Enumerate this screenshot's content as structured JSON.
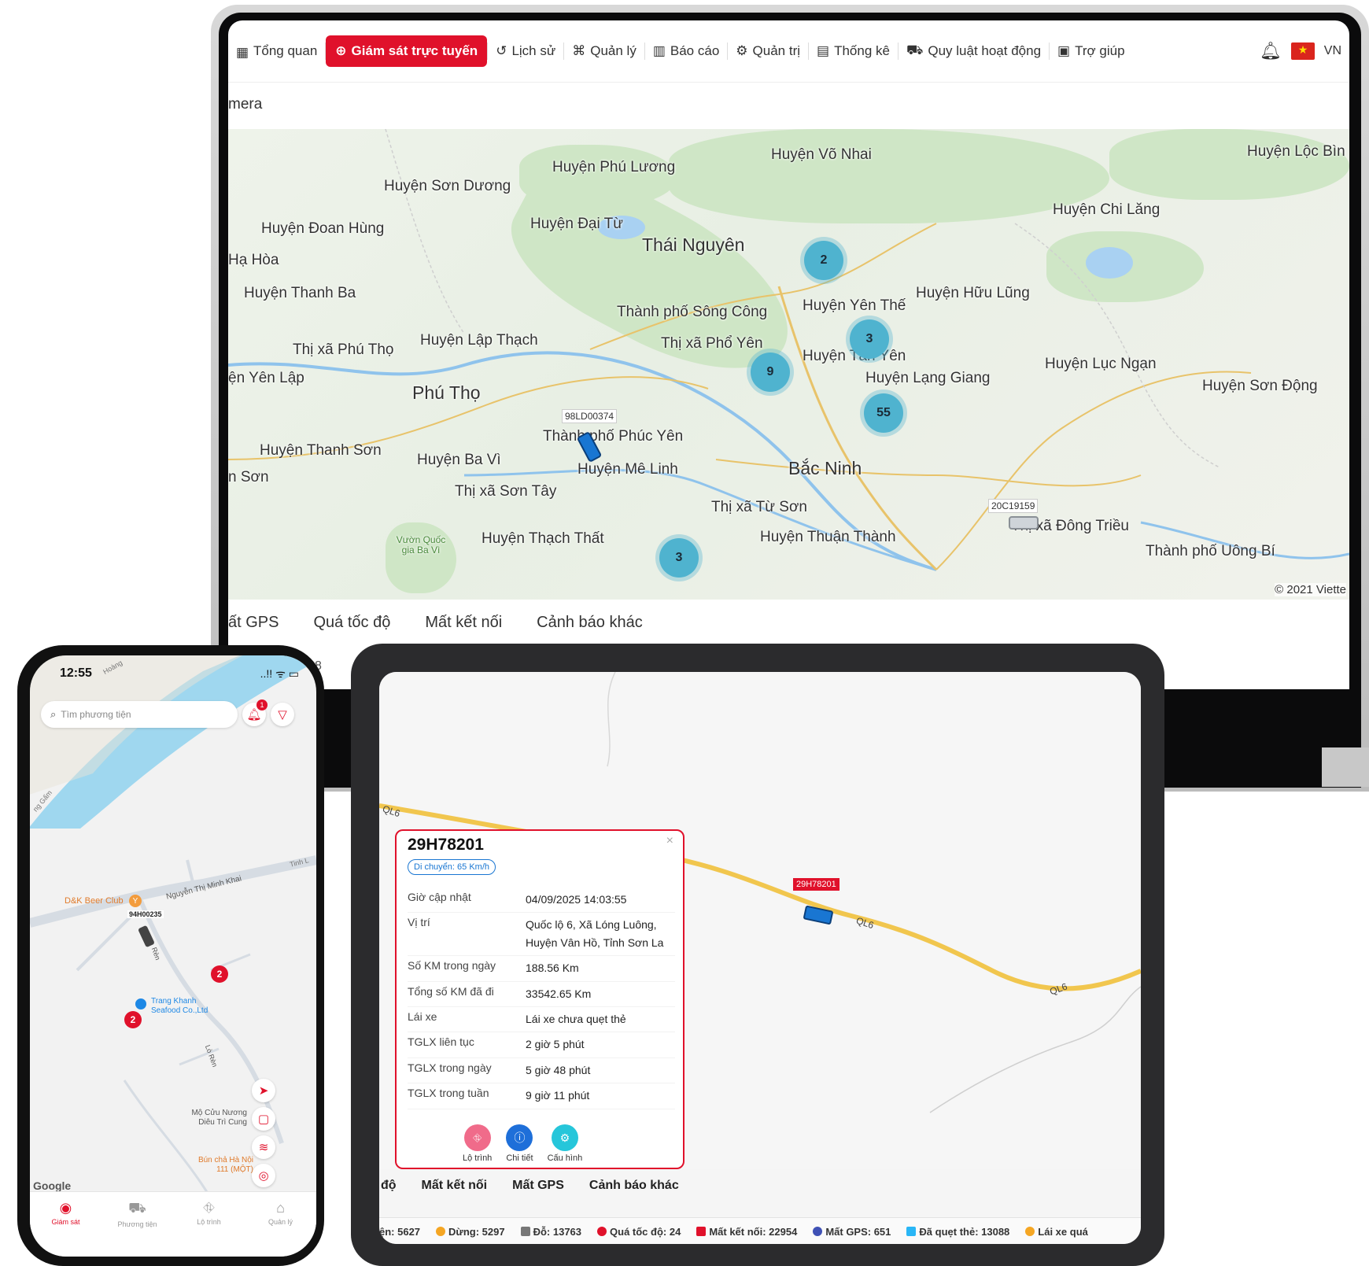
{
  "laptop": {
    "nav": [
      {
        "label": "Tổng quan",
        "icon": "grid-icon"
      },
      {
        "label": "Giám sát trực tuyến",
        "icon": "target-icon",
        "active": true
      },
      {
        "label": "Lịch sử",
        "icon": "history-icon"
      },
      {
        "label": "Quản lý",
        "icon": "hierarchy-icon"
      },
      {
        "label": "Báo cáo",
        "icon": "bar-chart-icon"
      },
      {
        "label": "Quản trị",
        "icon": "gear-icon"
      },
      {
        "label": "Thống kê",
        "icon": "clipboard-icon"
      },
      {
        "label": "Quy luật hoạt động",
        "icon": "route-rules-icon"
      },
      {
        "label": "Trợ giúp",
        "icon": "help-icon"
      }
    ],
    "language": "VN",
    "section_title": "mera",
    "map": {
      "places": [
        {
          "name": "Huyện Phú Lương"
        },
        {
          "name": "Huyện Võ Nhai"
        },
        {
          "name": "Huyện Lộc Bìn"
        },
        {
          "name": "Huyện Sơn Dương"
        },
        {
          "name": "Huyện Chi Lăng"
        },
        {
          "name": "Huyện Đoan Hùng"
        },
        {
          "name": "Huyện Đại Từ"
        },
        {
          "name": "Thái Nguyên"
        },
        {
          "name": "Hạ Hòa"
        },
        {
          "name": "Huyện Thanh Ba"
        },
        {
          "name": "Huyện Hữu Lũng"
        },
        {
          "name": "Huyện Yên Thế"
        },
        {
          "name": "Thành phố Sông Công"
        },
        {
          "name": "Thị xã Phú Thọ"
        },
        {
          "name": "Huyện Lập Thạch"
        },
        {
          "name": "Thị xã Phổ Yên"
        },
        {
          "name": "Huyện Tân Yên"
        },
        {
          "name": "Huyện Lục Ngạn"
        },
        {
          "name": "ện Yên Lập"
        },
        {
          "name": "Huyện Lạng Giang"
        },
        {
          "name": "Huyện Sơn Động"
        },
        {
          "name": "Phú Thọ"
        },
        {
          "name": "Thành phố Phúc Yên"
        },
        {
          "name": "Huyện Thanh Sơn"
        },
        {
          "name": "Huyện Ba Vì"
        },
        {
          "name": "Huyện Mê Linh"
        },
        {
          "name": "Bắc Ninh"
        },
        {
          "name": "n Sơn"
        },
        {
          "name": "Thị xã Sơn Tây"
        },
        {
          "name": "Thị xã Từ Sơn"
        },
        {
          "name": "Thị xã Đông Triều"
        },
        {
          "name": "Huyện Thạch Thất"
        },
        {
          "name": "Huyện Thuận Thành"
        },
        {
          "name": "Thành phố Uông Bí"
        },
        {
          "name": "Vườn Quốc gia Ba Vì"
        }
      ],
      "clusters": [
        "2",
        "3",
        "9",
        "55",
        "3"
      ],
      "plates": [
        "98LD00374",
        "20C19159"
      ],
      "copyright": "© 2021 Viette"
    },
    "tabs": [
      "ất GPS",
      "Quá tốc độ",
      "Mất kết nối",
      "Cảnh báo khác"
    ],
    "partial_number": "8"
  },
  "phone": {
    "time": "12:55",
    "status_icons": "..!! ᯤ ▭",
    "search_placeholder": "Tìm phương tiện",
    "notification_count": "1",
    "labels": {
      "beer_club": "D&K Beer Club",
      "street1": "Nguyễn Thị Minh Khai",
      "plate": "94H00235",
      "seafood": "Trang Khanh Seafood Co.,Ltd",
      "street2": "Lò Rèn",
      "street3": "Rèn",
      "tomb": "Mộ Cửu Nương Diêu Trì Cung",
      "bun_cha": "Bún chả Hà Nội 111 (MỘT)",
      "tinh": "Tinh L",
      "ong_gam": "ng Gấm",
      "hoang": "Hoàng"
    },
    "clusters": [
      "2",
      "2"
    ],
    "google": "Google",
    "tabs": [
      {
        "label": "Giám sát",
        "icon": "location-pin-icon",
        "active": true
      },
      {
        "label": "Phương tiện",
        "icon": "car-icon"
      },
      {
        "label": "Lộ trình",
        "icon": "map-route-icon"
      },
      {
        "label": "Quản lý",
        "icon": "home-icon"
      }
    ]
  },
  "tablet": {
    "roads": [
      "QL6",
      "QL6",
      "QL6"
    ],
    "plate": "29H78201",
    "popup": {
      "title": "29H78201",
      "status": "Di chuyển: 65 Km/h",
      "rows": [
        {
          "k": "Giờ cập nhật",
          "v": "04/09/2025 14:03:55"
        },
        {
          "k": "Vị trí",
          "v": "Quốc lộ 6, Xã Lóng Luông, Huyện Vân Hồ, Tỉnh Sơn La"
        },
        {
          "k": "Số KM trong ngày",
          "v": "188.56 Km"
        },
        {
          "k": "Tổng số KM đã đi",
          "v": "33542.65 Km"
        },
        {
          "k": "Lái xe",
          "v": "Lái xe chưa quẹt thẻ"
        },
        {
          "k": "TGLX liên tục",
          "v": "2 giờ 5 phút"
        },
        {
          "k": "TGLX trong ngày",
          "v": "5 giờ 48 phút"
        },
        {
          "k": "TGLX trong tuần",
          "v": "9 giờ 11 phút"
        }
      ],
      "actions": [
        {
          "label": "Lộ trình",
          "color": "#f06b8a",
          "icon": "route-icon"
        },
        {
          "label": "Chi tiết",
          "color": "#1e6fd9",
          "icon": "info-icon"
        },
        {
          "label": "Cấu hình",
          "color": "#26c6da",
          "icon": "gear-icon"
        }
      ]
    },
    "tabs": [
      "độ",
      "Mất kết nối",
      "Mất GPS",
      "Cảnh báo khác"
    ],
    "stats": [
      {
        "label": "ện: 5627",
        "color": ""
      },
      {
        "label": "Dừng: 5297",
        "color": "#f5a623"
      },
      {
        "label": "Đỗ: 13763",
        "color": "#777777"
      },
      {
        "label": "Quá tốc độ: 24",
        "color": "#e0112b"
      },
      {
        "label": "Mất kết nối: 22954",
        "color": "#e0112b"
      },
      {
        "label": "Mất GPS: 651",
        "color": "#3f51b5"
      },
      {
        "label": "Đã quẹt thẻ: 13088",
        "color": "#29b6f6"
      },
      {
        "label": "Lái xe quá",
        "color": "#f5a623"
      }
    ]
  }
}
